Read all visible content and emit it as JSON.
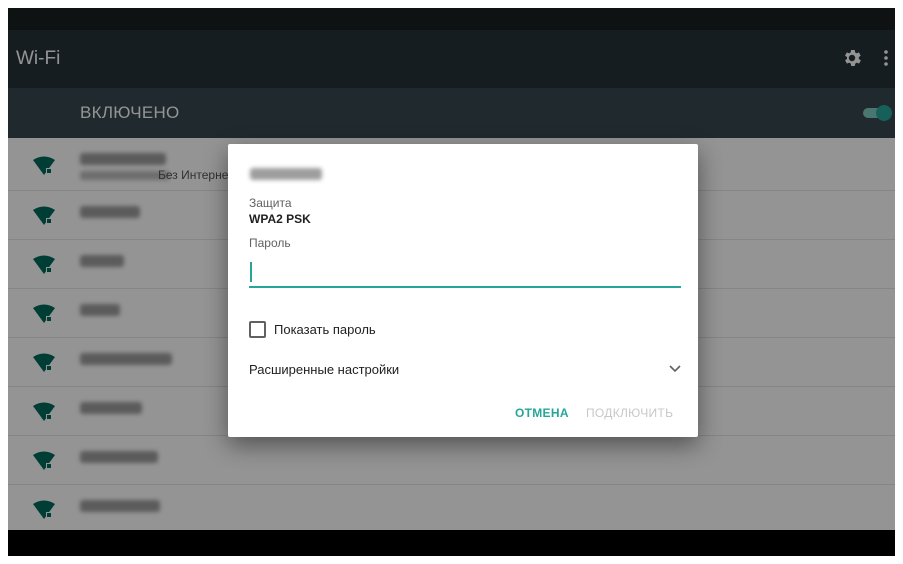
{
  "app": {
    "title": "Wi-Fi",
    "icons": [
      "gear-icon",
      "more-vert-icon"
    ]
  },
  "wifi_switch": {
    "label": "ВКЛЮЧЕНО",
    "state": "on",
    "accent": "#26a69a"
  },
  "networks": {
    "first_subtitle": "Без Интернета"
  },
  "dialog": {
    "security_label": "Защита",
    "security_value": "WPA2 PSK",
    "password_label": "Пароль",
    "password_value": "",
    "show_password_label": "Показать пароль",
    "show_password_checked": false,
    "advanced_label": "Расширенные настройки",
    "cancel_label": "ОТМЕНА",
    "connect_label": "ПОДКЛЮЧИТЬ",
    "connect_enabled": false
  },
  "colors": {
    "toolbar": "#263238",
    "switchbar": "#37474f",
    "accent": "#26a69a"
  }
}
